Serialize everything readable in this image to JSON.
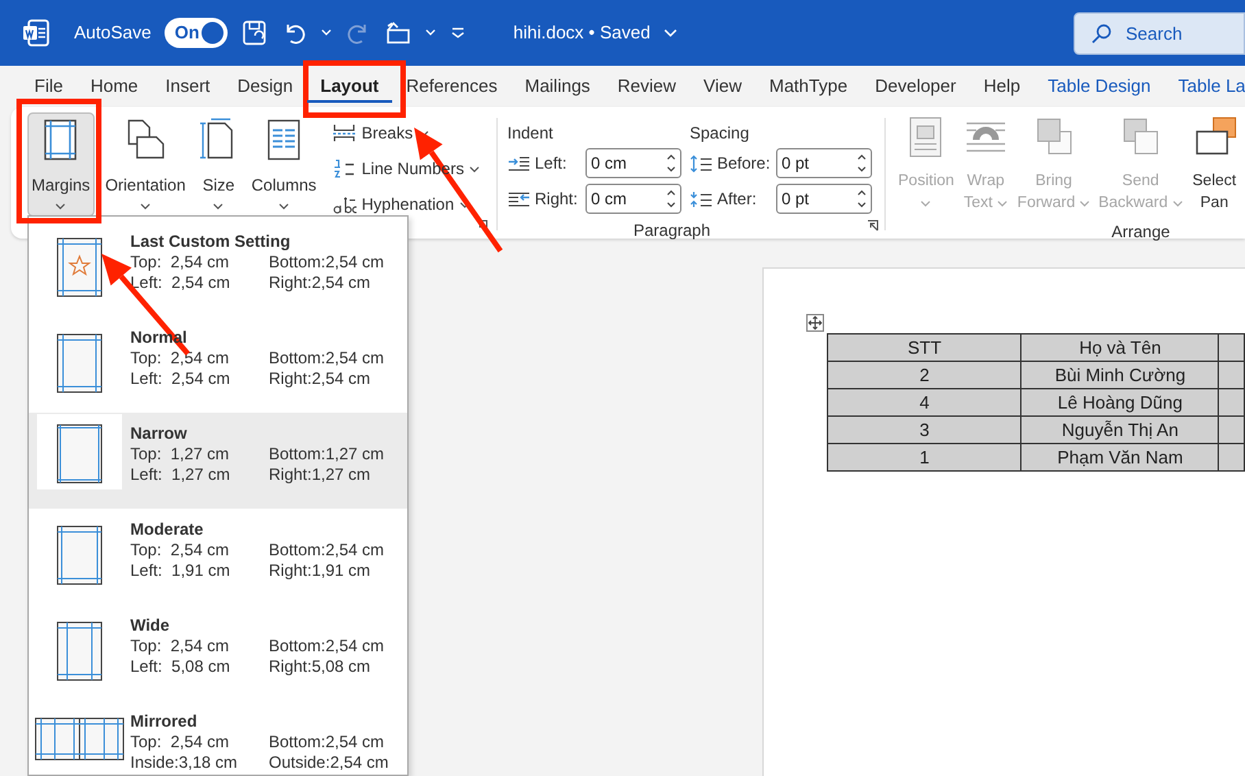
{
  "title_bar": {
    "autosave_label": "AutoSave",
    "autosave": {
      "label": "On",
      "on": true
    },
    "redo_disabled": true,
    "document_title": "hihi.docx • Saved",
    "search": {
      "placeholder": "Search"
    }
  },
  "tabs": [
    {
      "label": "File",
      "selected": false,
      "contextual": false
    },
    {
      "label": "Home",
      "selected": false,
      "contextual": false
    },
    {
      "label": "Insert",
      "selected": false,
      "contextual": false
    },
    {
      "label": "Design",
      "selected": false,
      "contextual": false
    },
    {
      "label": "Layout",
      "selected": true,
      "contextual": false
    },
    {
      "label": "References",
      "selected": false,
      "contextual": false
    },
    {
      "label": "Mailings",
      "selected": false,
      "contextual": false
    },
    {
      "label": "Review",
      "selected": false,
      "contextual": false
    },
    {
      "label": "View",
      "selected": false,
      "contextual": false
    },
    {
      "label": "MathType",
      "selected": false,
      "contextual": false
    },
    {
      "label": "Developer",
      "selected": false,
      "contextual": false
    },
    {
      "label": "Help",
      "selected": false,
      "contextual": false
    },
    {
      "label": "Table Design",
      "selected": false,
      "contextual": true
    },
    {
      "label": "Table La",
      "selected": false,
      "contextual": true
    }
  ],
  "ribbon": {
    "page_setup": {
      "large_buttons": [
        {
          "label": "Margins",
          "kind": "margins",
          "pressed": true
        },
        {
          "label": "Orientation",
          "kind": "orientation",
          "pressed": false
        },
        {
          "label": "Size",
          "kind": "size",
          "pressed": false
        },
        {
          "label": "Columns",
          "kind": "columns",
          "pressed": false
        }
      ],
      "small_buttons": [
        {
          "label": "Breaks",
          "kind": "breaks"
        },
        {
          "label": "Line Numbers",
          "kind": "line-numbers"
        },
        {
          "label": "Hyphenation",
          "kind": "hyphenation"
        }
      ]
    },
    "paragraph": {
      "title": "Paragraph",
      "indent": {
        "title": "Indent",
        "fields": [
          {
            "label": "Left:",
            "value": "0 cm"
          },
          {
            "label": "Right:",
            "value": "0 cm"
          }
        ]
      },
      "spacing": {
        "title": "Spacing",
        "fields": [
          {
            "label": "Before:",
            "value": "0 pt"
          },
          {
            "label": "After:",
            "value": "0 pt"
          }
        ]
      }
    },
    "arrange": {
      "title": "Arrange",
      "buttons": [
        {
          "kind": "position",
          "lines": [
            "Position"
          ],
          "caret": true,
          "disabled": true
        },
        {
          "kind": "wrap",
          "lines": [
            "Wrap",
            "Text"
          ],
          "caret": true,
          "disabled": true
        },
        {
          "kind": "forward",
          "lines": [
            "Bring",
            "Forward"
          ],
          "caret": true,
          "disabled": true
        },
        {
          "kind": "backward",
          "lines": [
            "Send",
            "Backward"
          ],
          "caret": true,
          "disabled": true
        },
        {
          "kind": "selection",
          "lines": [
            "Select",
            "Pan"
          ],
          "caret": false,
          "disabled": false
        }
      ]
    }
  },
  "margins_menu": {
    "items": [
      {
        "kind": "custom",
        "name": "Last Custom Setting",
        "selected": false,
        "values": [
          "Top:  2,54 cm",
          "Bottom:2,54 cm",
          "Left:  2,54 cm",
          "Right:2,54 cm"
        ]
      },
      {
        "kind": "normal",
        "name": "Normal",
        "selected": false,
        "values": [
          "Top:  2,54 cm",
          "Bottom:2,54 cm",
          "Left:  2,54 cm",
          "Right:2,54 cm"
        ]
      },
      {
        "kind": "narrow",
        "name": "Narrow",
        "selected": true,
        "values": [
          "Top:  1,27 cm",
          "Bottom:1,27 cm",
          "Left:  1,27 cm",
          "Right:1,27 cm"
        ]
      },
      {
        "kind": "moderate",
        "name": "Moderate",
        "selected": false,
        "values": [
          "Top:  2,54 cm",
          "Bottom:2,54 cm",
          "Left:  1,91 cm",
          "Right:1,91 cm"
        ]
      },
      {
        "kind": "wide",
        "name": "Wide",
        "selected": false,
        "values": [
          "Top:  2,54 cm",
          "Bottom:2,54 cm",
          "Left:  5,08 cm",
          "Right:5,08 cm"
        ]
      },
      {
        "kind": "mirrored",
        "name": "Mirrored",
        "selected": false,
        "values": [
          "Top:  2,54 cm",
          "Bottom:2,54 cm",
          "Inside:3,18 cm",
          "Outside:2,54 cm"
        ]
      }
    ]
  },
  "document": {
    "table": {
      "columns": [
        "STT",
        "Họ và Tên"
      ],
      "rows": [
        [
          "2",
          "Bùi Minh Cường"
        ],
        [
          "4",
          "Lê Hoàng Dũng"
        ],
        [
          "3",
          "Nguyễn Thị An"
        ],
        [
          "1",
          "Phạm Văn Nam"
        ]
      ]
    }
  }
}
